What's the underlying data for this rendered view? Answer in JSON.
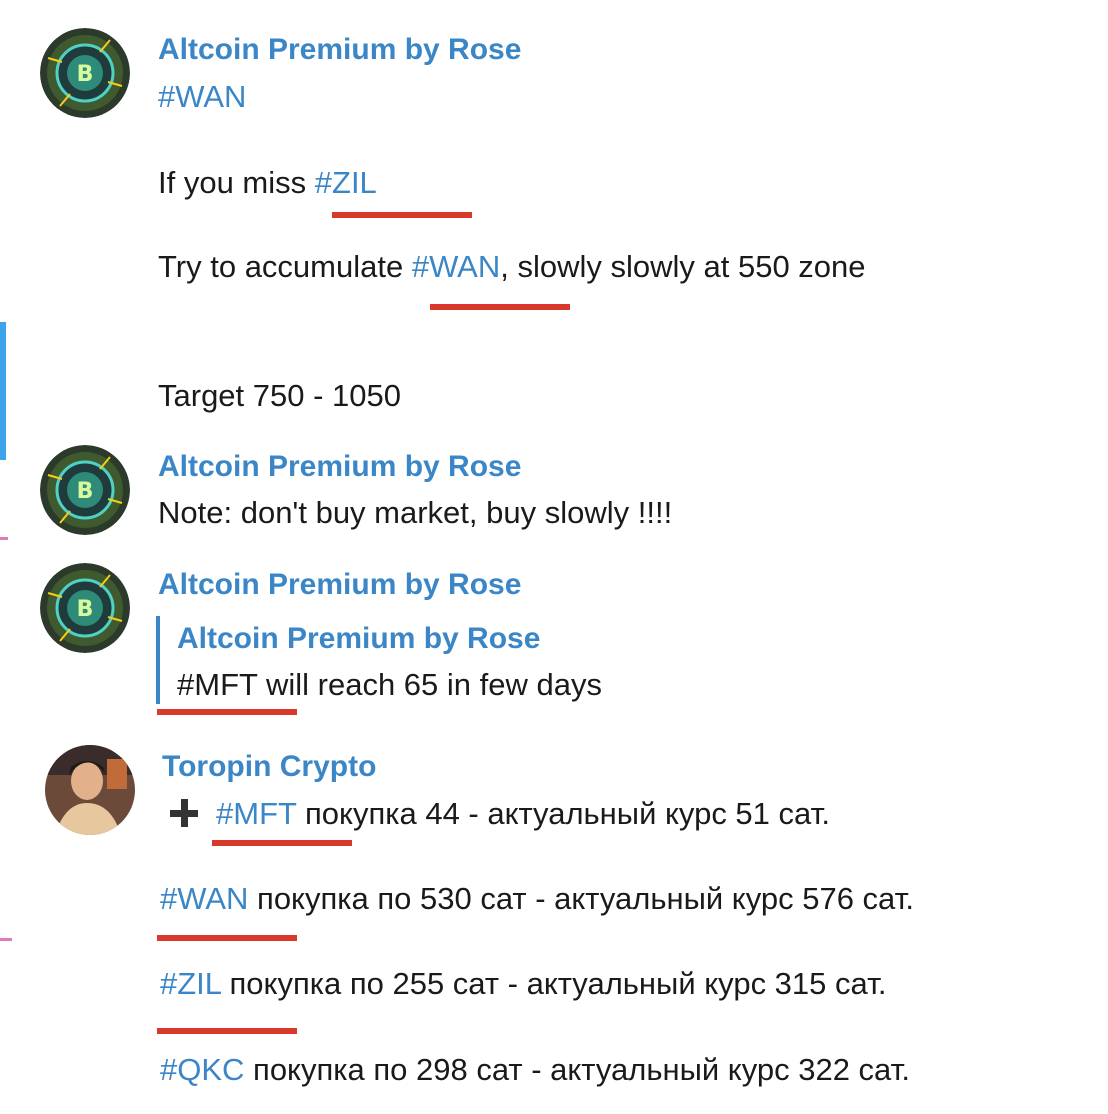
{
  "messages": [
    {
      "sender": "Altcoin Premium by Rose",
      "avatar_icon": "bitcoin-circuit-avatar",
      "line1": "#WAN",
      "line2_prefix": "If you miss ",
      "line2_tag": "#ZIL",
      "line3_prefix": "Try to accumulate ",
      "line3_tag": "#WAN",
      "line3_suffix": ", slowly slowly at 550 zone",
      "line4": "Target 750 - 1050"
    },
    {
      "sender": "Altcoin Premium by Rose",
      "avatar_icon": "bitcoin-circuit-avatar",
      "text": "Note: don't buy market, buy slowly !!!!"
    },
    {
      "sender": "Altcoin Premium by Rose",
      "avatar_icon": "bitcoin-circuit-avatar",
      "quote": {
        "sender": "Altcoin Premium by Rose",
        "text": "#MFT will reach 65 in few days"
      }
    },
    {
      "sender": "Toropin Crypto",
      "avatar_icon": "person-photo-avatar",
      "plus_icon": "plus-icon",
      "row1_tag": "#MFT",
      "row1_text": " покупка 44 - актуальный курс 51 сат.",
      "row2_tag": "#WAN",
      "row2_text": " покупка по 530 сат - актуальный курс 576 сат.",
      "row3_tag": "#ZIL",
      "row3_text": " покупка по 255 сат - актуальный курс 315 сат.",
      "row4_tag": "#QKC",
      "row4_text": " покупка по 298 сат - актуальный курс 322 сат."
    }
  ],
  "colors": {
    "link": "#3b86c6",
    "underline_annotation": "#d9392b",
    "text": "#1a1a1a"
  }
}
